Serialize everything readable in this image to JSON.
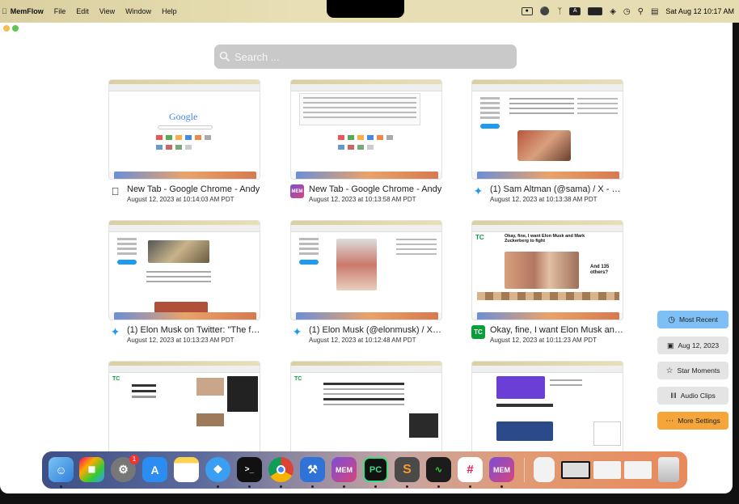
{
  "menubar": {
    "app_name": "MemFlow",
    "menus": [
      "File",
      "Edit",
      "View",
      "Window",
      "Help"
    ],
    "datetime": "Sat Aug 12  10:17 AM"
  },
  "search": {
    "placeholder": "Search ..."
  },
  "cards": [
    {
      "title": "New Tab - Google Chrome - Andy",
      "date": "August 12, 2023 at 10:14:03 AM PDT",
      "icon": "apple-icon",
      "thumb": "google"
    },
    {
      "title": "New Tab - Google Chrome - Andy",
      "date": "August 12, 2023 at 10:13:58 AM PDT",
      "icon": "memflow-icon",
      "thumb": "google-suggest"
    },
    {
      "title": "(1) Sam Altman (@sama) / X - Goo...",
      "date": "August 12, 2023 at 10:13:38 AM PDT",
      "icon": "twitter-icon",
      "thumb": "twitter"
    },
    {
      "title": "(1) Elon Musk on Twitter: \"The fig...",
      "date": "August 12, 2023 at 10:13:23 AM PDT",
      "icon": "twitter-icon",
      "thumb": "twitter"
    },
    {
      "title": "(1) Elon Musk (@elonmusk) / X - G...",
      "date": "August 12, 2023 at 10:12:48 AM PDT",
      "icon": "twitter-icon",
      "thumb": "twitter"
    },
    {
      "title": "Okay, fine, I want Elon Musk and...",
      "date": "August 12, 2023 at 10:11:23 AM PDT",
      "icon": "techcrunch-icon",
      "thumb": "techcrunch"
    },
    {
      "title": "",
      "date": "",
      "icon": "",
      "thumb": "techcrunch"
    },
    {
      "title": "",
      "date": "",
      "icon": "",
      "thumb": "techcrunch"
    },
    {
      "title": "",
      "date": "",
      "icon": "",
      "thumb": "techcrunch"
    }
  ],
  "sidebar": {
    "most_recent": "Most Recent",
    "date": "Aug 12, 2023",
    "star_moments": "Star Moments",
    "audio_clips": "Audio Clips",
    "more_settings": "More Settings"
  },
  "dock": {
    "badge": "1",
    "mem_label": "MEM",
    "pc_label": "PC"
  },
  "thumb_text": {
    "google_logo": "Google",
    "tc": "TC",
    "and_others": "And 135 others?",
    "okay_fine": "Okay, fine, I want Elon Musk and Mark Zuckerberg to fight"
  },
  "colors": {
    "accent_blue": "#7ec0f5",
    "orange": "#f6a53a",
    "twitter": "#1d9bf0",
    "techcrunch": "#0a9e3a"
  }
}
